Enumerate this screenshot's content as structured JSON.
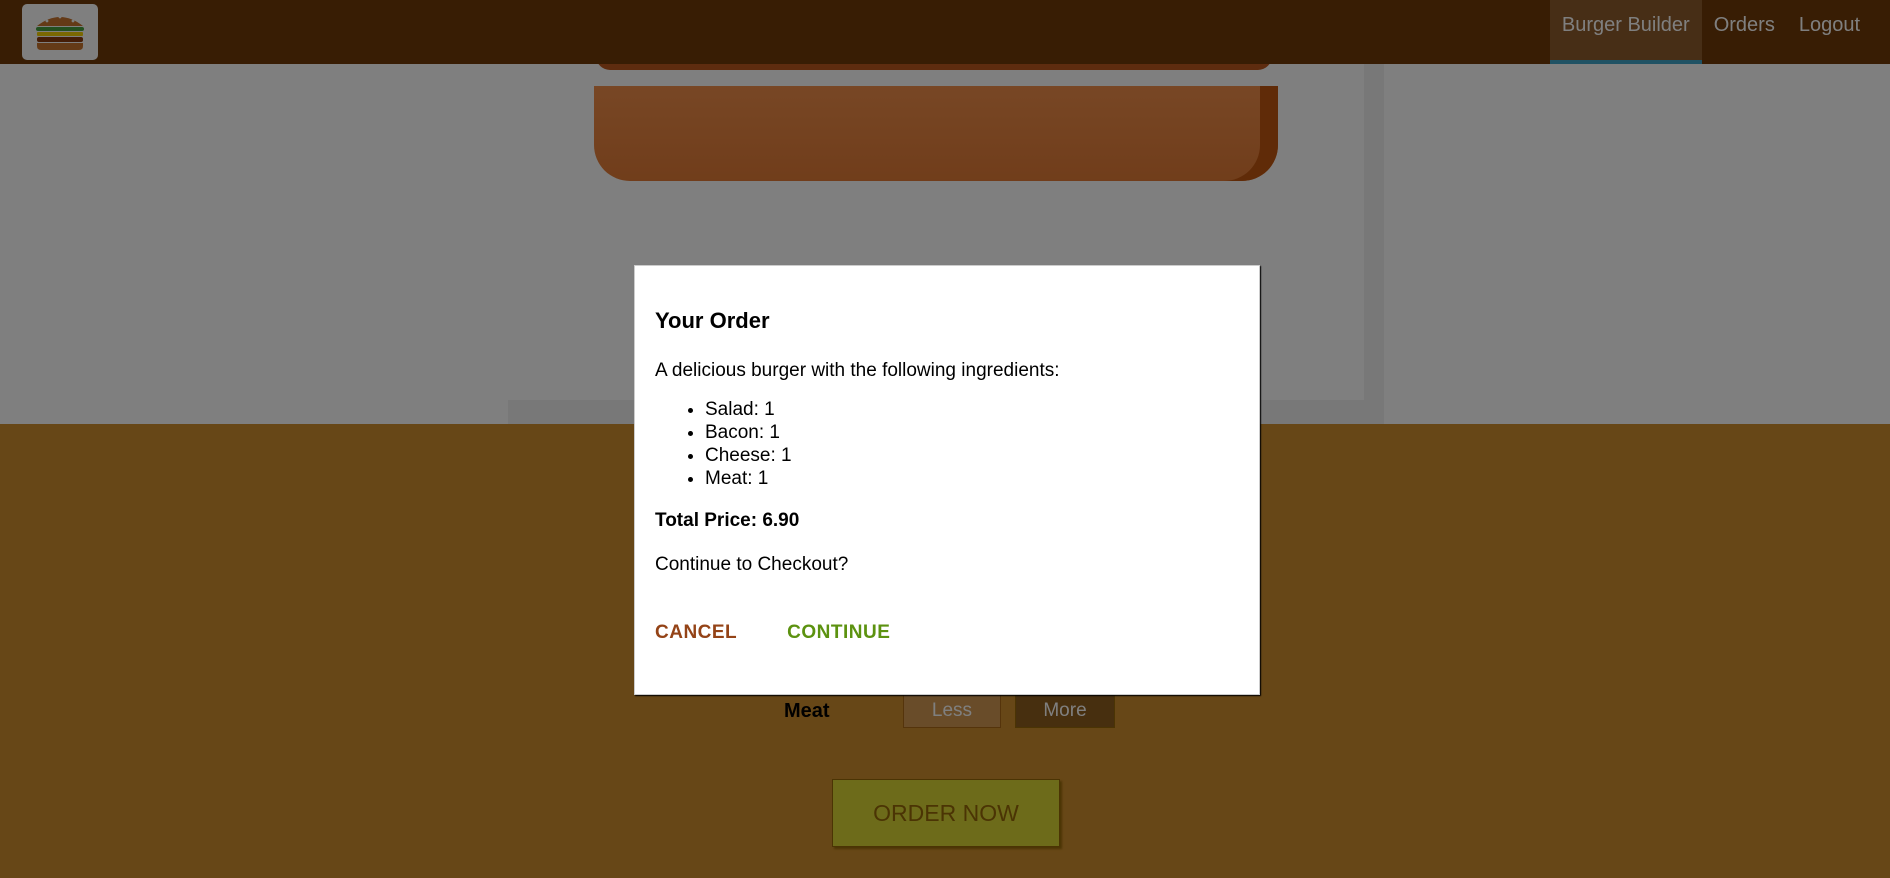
{
  "toolbar": {
    "logo_icon": "burger-logo-icon",
    "nav": [
      {
        "label": "Burger Builder",
        "active": true
      },
      {
        "label": "Orders",
        "active": false
      },
      {
        "label": "Logout",
        "active": false
      }
    ]
  },
  "colors": {
    "toolbar": "#703b09",
    "active_nav_border": "#40a4c8",
    "controls_background": "#cf8f2e",
    "cancel": "#944317",
    "continue": "#5c9210"
  },
  "controls": {
    "visible_row": {
      "label": "Meat",
      "less": "Less",
      "more": "More"
    },
    "order_button": "ORDER NOW"
  },
  "modal": {
    "title": "Your Order",
    "intro": "A delicious burger with the following ingredients:",
    "ingredients": [
      {
        "name": "Salad",
        "amount": 1,
        "text": "Salad: 1"
      },
      {
        "name": "Bacon",
        "amount": 1,
        "text": "Bacon: 1"
      },
      {
        "name": "Cheese",
        "amount": 1,
        "text": "Cheese: 1"
      },
      {
        "name": "Meat",
        "amount": 1,
        "text": "Meat: 1"
      }
    ],
    "total": "Total Price: 6.90",
    "question": "Continue to Checkout?",
    "cancel": "CANCEL",
    "continue": "CONTINUE"
  }
}
